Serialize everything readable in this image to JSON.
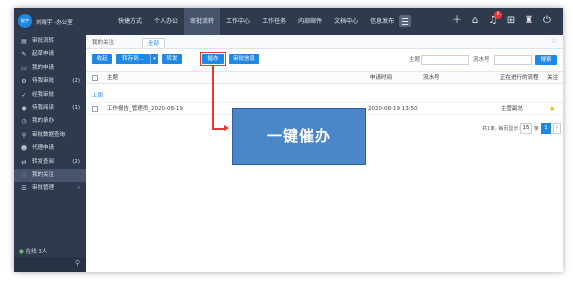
{
  "app": {
    "logo_text": "能宇",
    "user_label": "刘晓宇 -办公室"
  },
  "topnav": {
    "items": [
      "快捷方式",
      "个人办公",
      "审批流转",
      "工作中心",
      "工作任务",
      "内部邮件",
      "文档中心",
      "信息发布"
    ],
    "active": "审批流转",
    "notification_count": "6"
  },
  "sidebar": {
    "items": [
      {
        "label": "审批流转",
        "icon": "doc-icon",
        "count": ""
      },
      {
        "label": "起草申请",
        "icon": "edit-icon",
        "count": ""
      },
      {
        "label": "我的申请",
        "icon": "folder-icon",
        "count": ""
      },
      {
        "label": "待我审批",
        "icon": "gear-icon",
        "count": "(2)"
      },
      {
        "label": "经我审批",
        "icon": "check-icon",
        "count": ""
      },
      {
        "label": "待我阅读",
        "icon": "eye-icon",
        "count": "(1)"
      },
      {
        "label": "我的承办",
        "icon": "clock-icon",
        "count": ""
      },
      {
        "label": "审批数据查询",
        "icon": "search-icon",
        "count": ""
      },
      {
        "label": "代理申请",
        "icon": "user-icon",
        "count": ""
      },
      {
        "label": "转发查阅",
        "icon": "share-icon",
        "count": "(2)"
      },
      {
        "label": "我的关注",
        "icon": "heart-icon",
        "count": ""
      },
      {
        "label": "审批管理",
        "icon": "settings-icon",
        "count": "›"
      }
    ],
    "active_index": 10,
    "online_text": "在线 3人"
  },
  "tabs": {
    "current": "我的关注",
    "filter": "全部"
  },
  "toolbar": {
    "buttons": [
      "收起",
      "转存到...",
      "转发",
      "催办",
      "审批信息"
    ],
    "subject_label": "主题",
    "serial_label": "流水号",
    "search_label": "搜索"
  },
  "table": {
    "headers": [
      "主题",
      "申请时间",
      "流水号",
      "正在进行的流程",
      "关注"
    ],
    "group_label": "上周",
    "rows": [
      {
        "subject": "工作报告_管理员_2020-08-19",
        "time": "2020-08-19 13:50",
        "serial": "",
        "process": "主管副总",
        "star": "★"
      }
    ]
  },
  "pager": {
    "summary": "共1条, 每页显示:",
    "page_size": "15",
    "unit": "条",
    "current_page": "1"
  },
  "annotation": {
    "callout_text": "一键催办"
  },
  "colors": {
    "sidebar_bg": "#2f3a4c",
    "accent": "#1e88e5",
    "highlight": "#e53935",
    "callout_bg": "#4a86c8"
  }
}
